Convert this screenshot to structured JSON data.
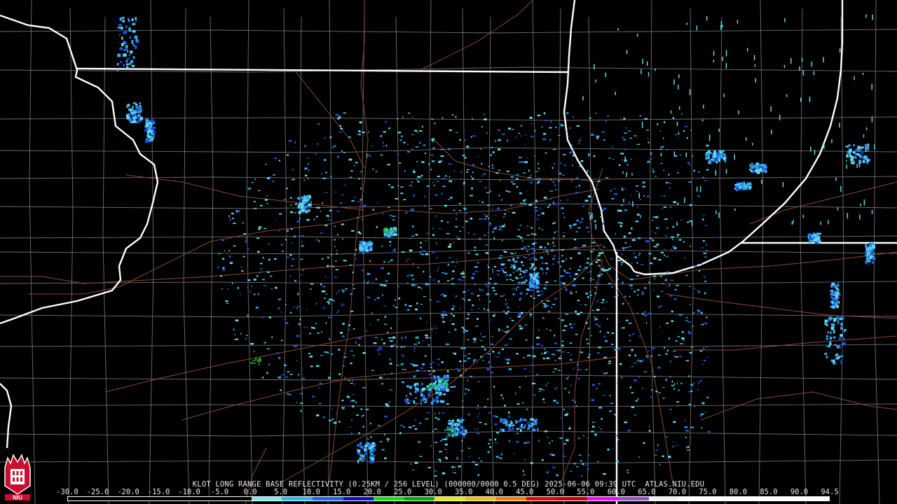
{
  "product": {
    "caption": "KLOT LONG RANGE BASE REFLECTIVITY (0.25KM / 256 LEVEL) (000000/0000 0.5 DEG) 2025-06-06 09:39 UTC  ATLAS.NIU.EDU",
    "logo_text": "NIU"
  },
  "legend": {
    "ticks": [
      "-30.0",
      "-25.0",
      "-20.0",
      "-15.0",
      "-10.0",
      "-5.0",
      "0.0",
      "5.0",
      "10.0",
      "15.0",
      "20.0",
      "25.0",
      "30.0",
      "35.0",
      "40.0",
      "45.0",
      "50.0",
      "55.0",
      "60.0",
      "65.0",
      "70.0",
      "75.0",
      "80.0",
      "85.0",
      "90.0",
      "94.5"
    ],
    "bins": [
      {
        "from": -30,
        "to": 0,
        "color": "#000000"
      },
      {
        "from": 0,
        "to": 5,
        "color": "#7ee8e8"
      },
      {
        "from": 5,
        "to": 10,
        "color": "#2fb8f0"
      },
      {
        "from": 10,
        "to": 15,
        "color": "#1e64e6"
      },
      {
        "from": 15,
        "to": 20,
        "color": "#1010c0"
      },
      {
        "from": 20,
        "to": 25,
        "color": "#10e010"
      },
      {
        "from": 25,
        "to": 30,
        "color": "#08a808"
      },
      {
        "from": 30,
        "to": 35,
        "color": "#e8e800"
      },
      {
        "from": 35,
        "to": 40,
        "color": "#e8c000"
      },
      {
        "from": 40,
        "to": 45,
        "color": "#f08000"
      },
      {
        "from": 45,
        "to": 50,
        "color": "#f00000"
      },
      {
        "from": 50,
        "to": 55,
        "color": "#c80000"
      },
      {
        "from": 55,
        "to": 60,
        "color": "#ff00ff"
      },
      {
        "from": 60,
        "to": 65,
        "color": "#9850c8"
      },
      {
        "from": 65,
        "to": 70,
        "color": "#f0f0f0"
      },
      {
        "from": 70,
        "to": 94.5,
        "color": "#ffffff"
      }
    ]
  },
  "colors": {
    "background": "#000000",
    "state_border": "#ffffff",
    "county_border": "#6e6e6e",
    "highway": "#8b4a2b",
    "echo_light": "#5fd8e8",
    "echo_mid": "#2fa8f0",
    "echo_strong": "#1e50e0",
    "echo_green": "#18c818"
  }
}
